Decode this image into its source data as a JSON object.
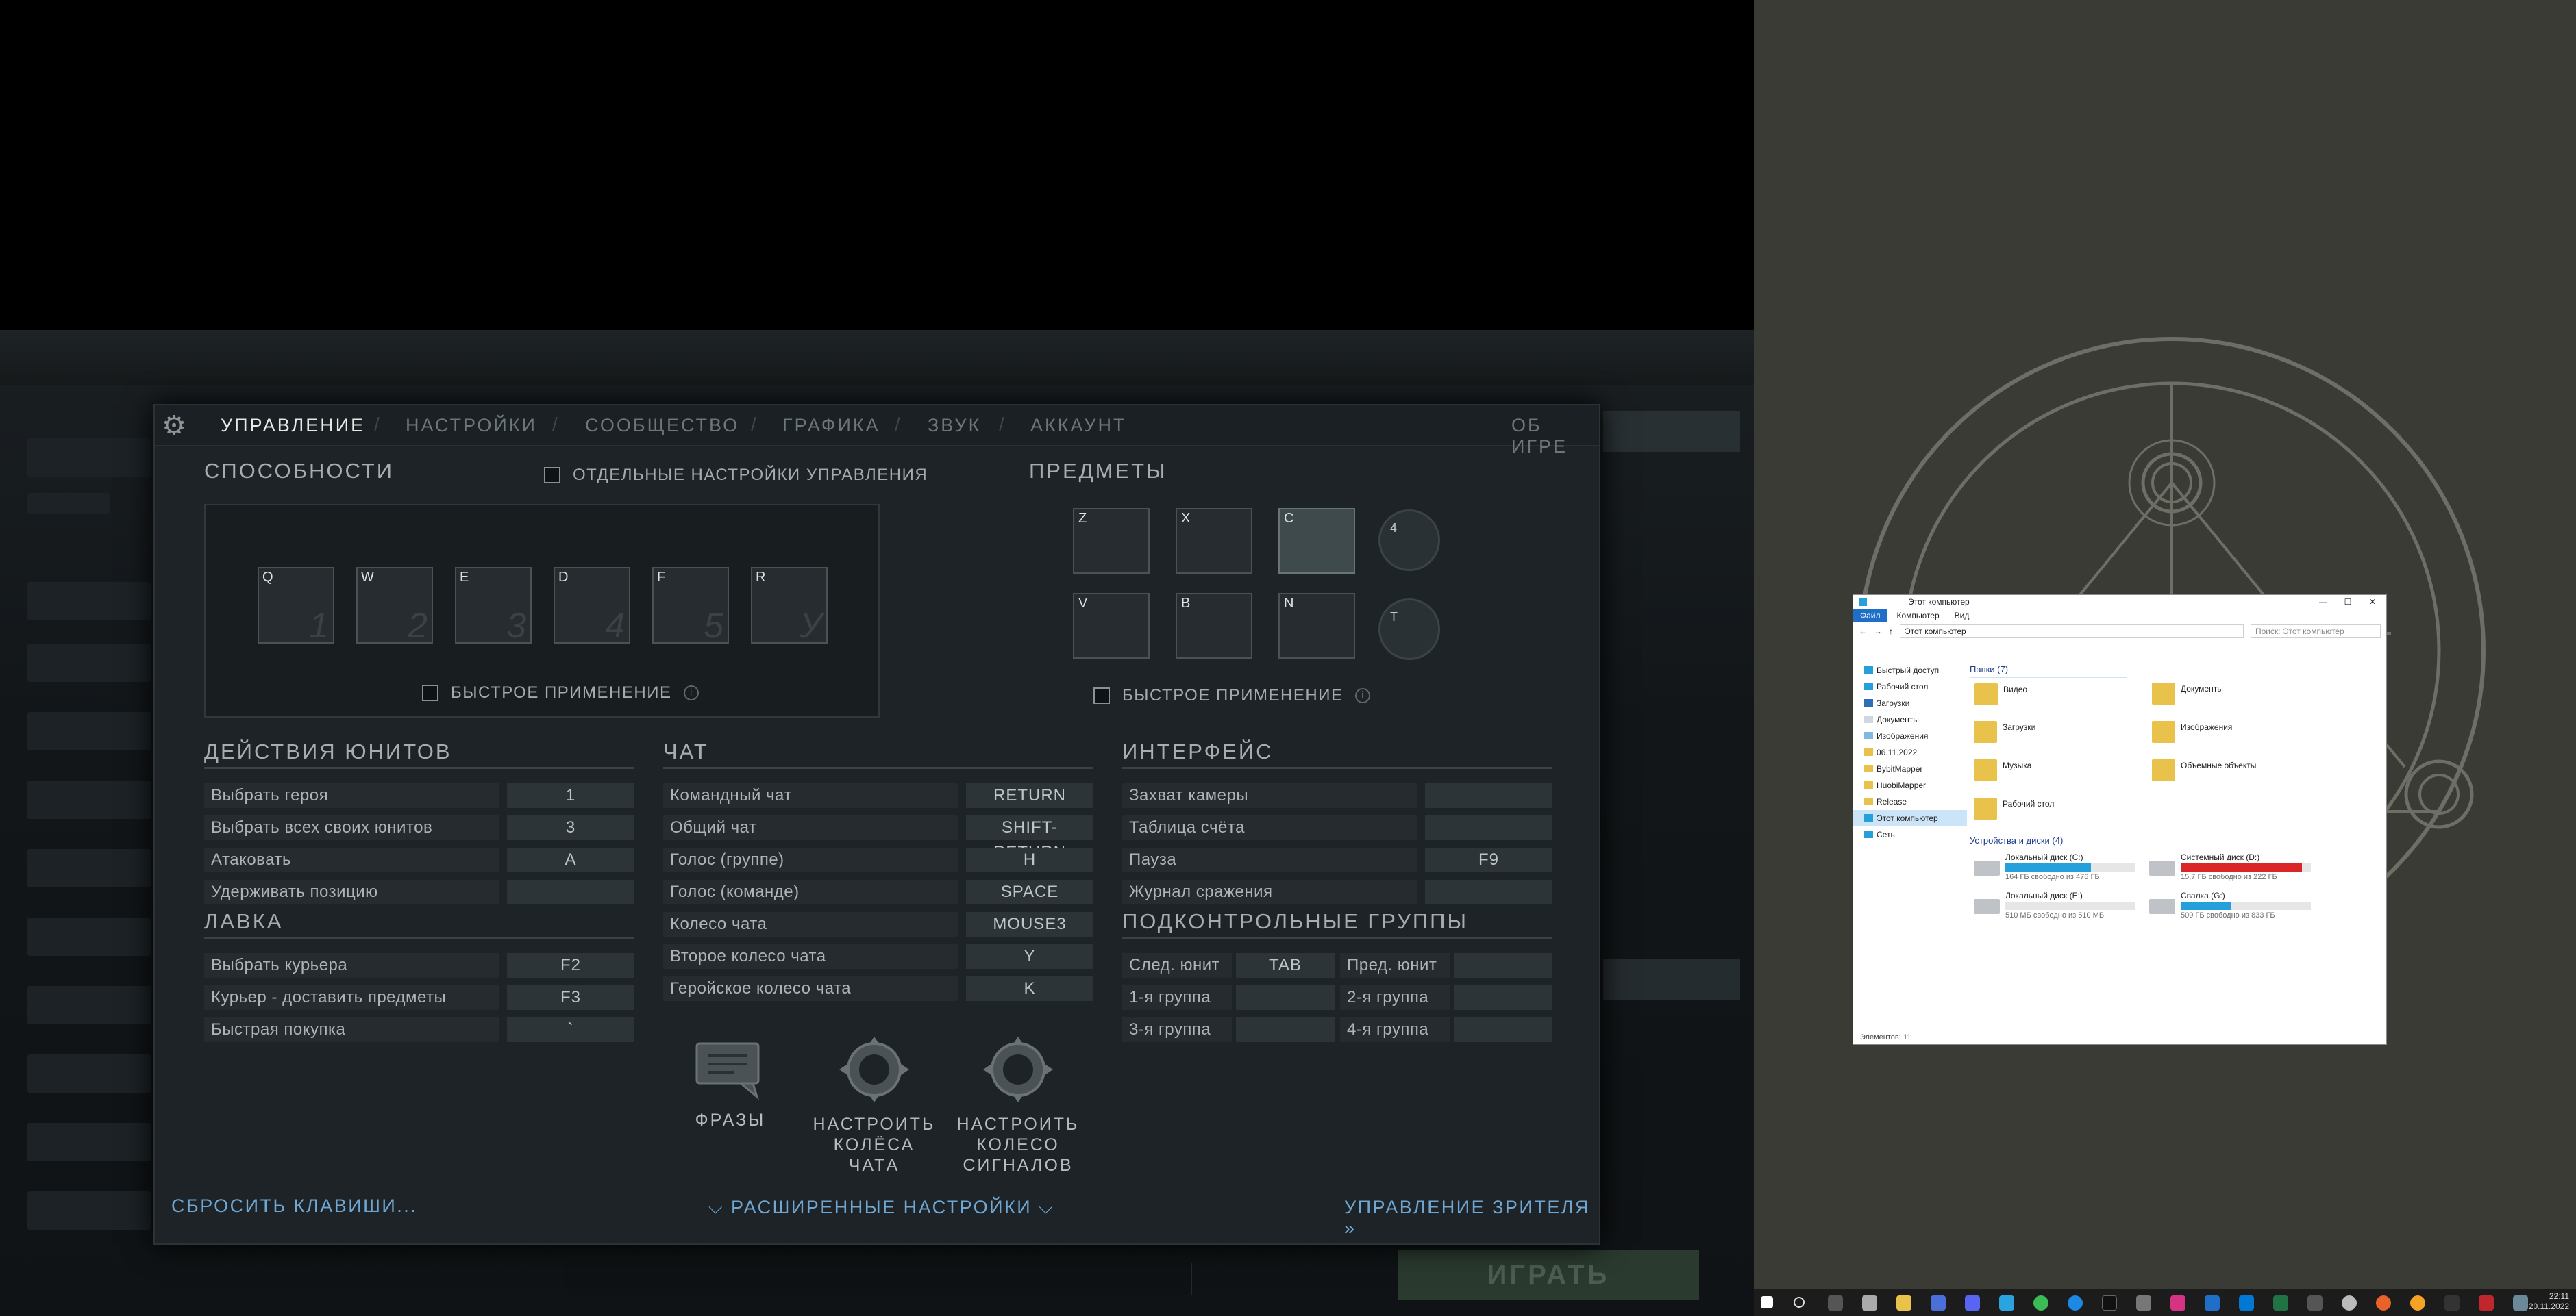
{
  "dialog": {
    "tabs": [
      "УПРАВЛЕНИЕ",
      "НАСТРОЙКИ",
      "СООБЩЕСТВО",
      "ГРАФИКА",
      "ЗВУК",
      "АККАУНТ"
    ],
    "about": "ОБ ИГРЕ",
    "abilities": {
      "title": "СПОСОБНОСТИ",
      "separate_settings": "ОТДЕЛЬНЫЕ НАСТРОЙКИ УПРАВЛЕНИЯ",
      "slots": [
        {
          "key": "Q",
          "num": "1"
        },
        {
          "key": "W",
          "num": "2"
        },
        {
          "key": "E",
          "num": "3"
        },
        {
          "key": "D",
          "num": "4"
        },
        {
          "key": "F",
          "num": "5"
        },
        {
          "key": "R",
          "num": "У"
        }
      ],
      "quick_cast": "БЫСТРОЕ ПРИМЕНЕНИЕ"
    },
    "items": {
      "title": "ПРЕДМЕТЫ",
      "slots_top": [
        "Z",
        "X",
        "C"
      ],
      "slots_bottom": [
        "V",
        "B",
        "N"
      ],
      "neutral_key": "4",
      "tp_key": "T",
      "quick_cast": "БЫСТРОЕ ПРИМЕНЕНИЕ"
    },
    "unit_actions": {
      "title": "ДЕЙСТВИЯ ЮНИТОВ",
      "rows": [
        {
          "label": "Выбрать героя",
          "value": "1"
        },
        {
          "label": "Выбрать всех своих юнитов",
          "value": "3"
        },
        {
          "label": "Атаковать",
          "value": "A"
        },
        {
          "label": "Удерживать позицию",
          "value": ""
        }
      ]
    },
    "shop": {
      "title": "ЛАВКА",
      "rows": [
        {
          "label": "Выбрать курьера",
          "value": "F2"
        },
        {
          "label": "Курьер - доставить предметы",
          "value": "F3"
        },
        {
          "label": "Быстрая покупка",
          "value": "`"
        }
      ]
    },
    "chat": {
      "title": "ЧАТ",
      "rows": [
        {
          "label": "Командный чат",
          "value": "RETURN"
        },
        {
          "label": "Общий чат",
          "value": "SHIFT-RETURN"
        },
        {
          "label": "Голос (группе)",
          "value": "H"
        },
        {
          "label": "Голос (команде)",
          "value": "SPACE"
        },
        {
          "label": "Колесо чата",
          "value": "MOUSE3"
        },
        {
          "label": "Второе колесо чата",
          "value": "Y"
        },
        {
          "label": "Геройское колесо чата",
          "value": "K"
        }
      ],
      "icons": [
        "ФРАЗЫ",
        "НАСТРОИТЬ\nКОЛЁСА ЧАТА",
        "НАСТРОИТЬ\nКОЛЕСО\nСИГНАЛОВ"
      ]
    },
    "interface": {
      "title": "ИНТЕРФЕЙС",
      "rows": [
        {
          "label": "Захват камеры",
          "value": ""
        },
        {
          "label": "Таблица счёта",
          "value": ""
        },
        {
          "label": "Пауза",
          "value": "F9"
        },
        {
          "label": "Журнал сражения",
          "value": ""
        }
      ]
    },
    "control_groups": {
      "title": "ПОДКОНТРОЛЬНЫЕ ГРУППЫ",
      "rows": [
        {
          "l1": "След. юнит",
          "v1": "TAB",
          "l2": "Пред. юнит",
          "v2": ""
        },
        {
          "l1": "1-я группа",
          "v1": "",
          "l2": "2-я группа",
          "v2": ""
        },
        {
          "l1": "3-я группа",
          "v1": "",
          "l2": "4-я группа",
          "v2": ""
        }
      ]
    },
    "footer": {
      "reset": "СБРОСИТЬ КЛАВИШИ...",
      "advanced": "РАСШИРЕННЫЕ НАСТРОЙКИ",
      "spectator": "УПРАВЛЕНИЕ ЗРИТЕЛЯ"
    }
  },
  "game": {
    "play_button": "ИГРАТЬ"
  },
  "explorer": {
    "title": "Этот компьютер",
    "ribbon": [
      "Файл",
      "Компьютер",
      "Вид"
    ],
    "address": "Этот компьютер",
    "search_placeholder": "Поиск: Этот компьютер",
    "nav": [
      "Быстрый доступ",
      "Рабочий стол",
      "Загрузки",
      "Документы",
      "Изображения",
      "06.11.2022",
      "BybitMapper",
      "HuobiMapper",
      "Release",
      "Этот компьютер",
      "Сеть"
    ],
    "folders_header": "Папки (7)",
    "folders": [
      "Видео",
      "Документы",
      "Загрузки",
      "Изображения",
      "Музыка",
      "Объемные объекты",
      "Рабочий стол"
    ],
    "drives_header": "Устройства и диски (4)",
    "drives": [
      {
        "name": "Локальный диск (C:)",
        "free": "164 ГБ свободно из 476 ГБ",
        "used": 0.66,
        "color": "#26a0da"
      },
      {
        "name": "Системный диск (D:)",
        "free": "15,7 ГБ свободно из 222 ГБ",
        "used": 0.93,
        "color": "#da2626"
      },
      {
        "name": "Локальный диск (E:)",
        "free": "510 МБ свободно из 510 МБ",
        "used": 0.0,
        "color": "#26a0da"
      },
      {
        "name": "Свалка (G:)",
        "free": "509 ГБ свободно из 833 ГБ",
        "used": 0.39,
        "color": "#26a0da"
      }
    ],
    "status": "Элементов: 11"
  },
  "taskbar": {
    "time": "22:11",
    "date": "20.11.2022"
  }
}
